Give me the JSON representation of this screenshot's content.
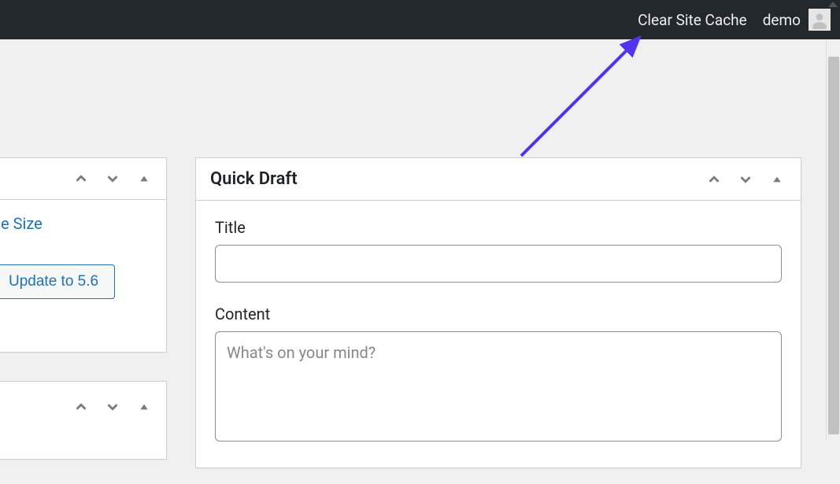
{
  "adminbar": {
    "clear_cache": "Clear Site Cache",
    "username": "demo"
  },
  "left_panel_1": {
    "link_text": "ne Size",
    "update_button": "Update to 5.6"
  },
  "quickdraft": {
    "title": "Quick Draft",
    "title_label": "Title",
    "title_value": "",
    "content_label": "Content",
    "content_placeholder": "What's on your mind?"
  }
}
